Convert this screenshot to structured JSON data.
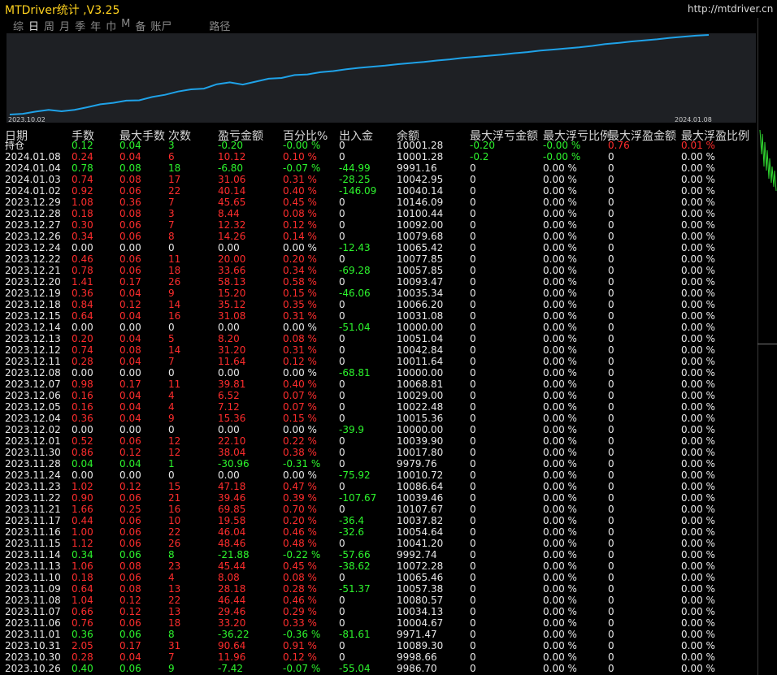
{
  "app_title": "MTDriver统计 ,V3.25",
  "url": "http://mtdriver.cn",
  "tabs": [
    {
      "label": "综",
      "active": false
    },
    {
      "label": "日",
      "active": true
    },
    {
      "label": "周",
      "active": false
    },
    {
      "label": "月",
      "active": false
    },
    {
      "label": "季",
      "active": false
    },
    {
      "label": "年",
      "active": false
    },
    {
      "label": "巾",
      "active": false
    },
    {
      "label": "M",
      "active": false
    },
    {
      "label": "备",
      "active": false
    },
    {
      "label": "账尸",
      "active": false
    },
    {
      "label": "路径",
      "active": false
    }
  ],
  "chart": {
    "start_date": "2023.10.02",
    "end_date": "2024.01.08",
    "line_color": "#1fa2e8",
    "equity": [
      10002,
      10004,
      10010,
      10015,
      10011,
      10015,
      10022,
      10030,
      10034,
      10040,
      10041,
      10050,
      10056,
      10065,
      10071,
      10073,
      10085,
      10090,
      10084,
      10092,
      10100,
      10102,
      10110,
      10112,
      10118,
      10121,
      10126,
      10130,
      10133,
      10136,
      10140,
      10143,
      10146,
      10150,
      10153,
      10157,
      10160,
      10163,
      10166,
      10170,
      10173,
      10177,
      10180,
      10183,
      10186,
      10190,
      10195,
      10198,
      10202,
      10205,
      10208,
      10212,
      10215,
      10218,
      10220
    ]
  },
  "columns": [
    "日期",
    "手数",
    "最大手数",
    "次数",
    "盈亏金额",
    "百分比%",
    "出入金",
    "余额",
    "最大浮亏金额",
    "最大浮亏比例",
    "最大浮盈金额",
    "最大浮盈比例"
  ],
  "rows": [
    {
      "c": [
        "持仓",
        "0.12",
        "0.04",
        "3",
        "-0.20",
        "-0.00 %",
        "0",
        "10001.28",
        "-0.20",
        "-0.00 %",
        "0.76",
        "0.01 %"
      ],
      "k": "g"
    },
    {
      "c": [
        "2024.01.08",
        "0.24",
        "0.04",
        "6",
        "10.12",
        "0.10 %",
        "0",
        "10001.28",
        "-0.2",
        "-0.00 %",
        "0",
        "0.00 %"
      ],
      "k": "r"
    },
    {
      "c": [
        "2024.01.04",
        "0.78",
        "0.08",
        "18",
        "-6.80",
        "-0.07 %",
        "-44.99",
        "9991.16",
        "0",
        "0.00 %",
        "0",
        "0.00 %"
      ],
      "k": "g"
    },
    {
      "c": [
        "2024.01.03",
        "0.74",
        "0.08",
        "17",
        "31.06",
        "0.31 %",
        "-28.25",
        "10042.95",
        "0",
        "0.00 %",
        "0",
        "0.00 %"
      ],
      "k": "r"
    },
    {
      "c": [
        "2024.01.02",
        "0.92",
        "0.06",
        "22",
        "40.14",
        "0.40 %",
        "-146.09",
        "10040.14",
        "0",
        "0.00 %",
        "0",
        "0.00 %"
      ],
      "k": "r"
    },
    {
      "c": [
        "2023.12.29",
        "1.08",
        "0.36",
        "7",
        "45.65",
        "0.45 %",
        "0",
        "10146.09",
        "0",
        "0.00 %",
        "0",
        "0.00 %"
      ],
      "k": "r"
    },
    {
      "c": [
        "2023.12.28",
        "0.18",
        "0.08",
        "3",
        "8.44",
        "0.08 %",
        "0",
        "10100.44",
        "0",
        "0.00 %",
        "0",
        "0.00 %"
      ],
      "k": "r"
    },
    {
      "c": [
        "2023.12.27",
        "0.30",
        "0.06",
        "7",
        "12.32",
        "0.12 %",
        "0",
        "10092.00",
        "0",
        "0.00 %",
        "0",
        "0.00 %"
      ],
      "k": "r"
    },
    {
      "c": [
        "2023.12.26",
        "0.34",
        "0.06",
        "8",
        "14.26",
        "0.14 %",
        "0",
        "10079.68",
        "0",
        "0.00 %",
        "0",
        "0.00 %"
      ],
      "k": "r"
    },
    {
      "c": [
        "2023.12.24",
        "0.00",
        "0.00",
        "0",
        "0.00",
        "0.00 %",
        "-12.43",
        "10065.42",
        "0",
        "0.00 %",
        "0",
        "0.00 %"
      ],
      "k": "w"
    },
    {
      "c": [
        "2023.12.22",
        "0.46",
        "0.06",
        "11",
        "20.00",
        "0.20 %",
        "0",
        "10077.85",
        "0",
        "0.00 %",
        "0",
        "0.00 %"
      ],
      "k": "r"
    },
    {
      "c": [
        "2023.12.21",
        "0.78",
        "0.06",
        "18",
        "33.66",
        "0.34 %",
        "-69.28",
        "10057.85",
        "0",
        "0.00 %",
        "0",
        "0.00 %"
      ],
      "k": "r"
    },
    {
      "c": [
        "2023.12.20",
        "1.41",
        "0.17",
        "26",
        "58.13",
        "0.58 %",
        "0",
        "10093.47",
        "0",
        "0.00 %",
        "0",
        "0.00 %"
      ],
      "k": "r"
    },
    {
      "c": [
        "2023.12.19",
        "0.36",
        "0.04",
        "9",
        "15.20",
        "0.15 %",
        "-46.06",
        "10035.34",
        "0",
        "0.00 %",
        "0",
        "0.00 %"
      ],
      "k": "r"
    },
    {
      "c": [
        "2023.12.18",
        "0.84",
        "0.12",
        "14",
        "35.12",
        "0.35 %",
        "0",
        "10066.20",
        "0",
        "0.00 %",
        "0",
        "0.00 %"
      ],
      "k": "r"
    },
    {
      "c": [
        "2023.12.15",
        "0.64",
        "0.04",
        "16",
        "31.08",
        "0.31 %",
        "0",
        "10031.08",
        "0",
        "0.00 %",
        "0",
        "0.00 %"
      ],
      "k": "r"
    },
    {
      "c": [
        "2023.12.14",
        "0.00",
        "0.00",
        "0",
        "0.00",
        "0.00 %",
        "-51.04",
        "10000.00",
        "0",
        "0.00 %",
        "0",
        "0.00 %"
      ],
      "k": "w"
    },
    {
      "c": [
        "2023.12.13",
        "0.20",
        "0.04",
        "5",
        "8.20",
        "0.08 %",
        "0",
        "10051.04",
        "0",
        "0.00 %",
        "0",
        "0.00 %"
      ],
      "k": "r"
    },
    {
      "c": [
        "2023.12.12",
        "0.74",
        "0.08",
        "14",
        "31.20",
        "0.31 %",
        "0",
        "10042.84",
        "0",
        "0.00 %",
        "0",
        "0.00 %"
      ],
      "k": "r"
    },
    {
      "c": [
        "2023.12.11",
        "0.28",
        "0.04",
        "7",
        "11.64",
        "0.12 %",
        "0",
        "10011.64",
        "0",
        "0.00 %",
        "0",
        "0.00 %"
      ],
      "k": "r"
    },
    {
      "c": [
        "2023.12.08",
        "0.00",
        "0.00",
        "0",
        "0.00",
        "0.00 %",
        "-68.81",
        "10000.00",
        "0",
        "0.00 %",
        "0",
        "0.00 %"
      ],
      "k": "w"
    },
    {
      "c": [
        "2023.12.07",
        "0.98",
        "0.17",
        "11",
        "39.81",
        "0.40 %",
        "0",
        "10068.81",
        "0",
        "0.00 %",
        "0",
        "0.00 %"
      ],
      "k": "r"
    },
    {
      "c": [
        "2023.12.06",
        "0.16",
        "0.04",
        "4",
        "6.52",
        "0.07 %",
        "0",
        "10029.00",
        "0",
        "0.00 %",
        "0",
        "0.00 %"
      ],
      "k": "r"
    },
    {
      "c": [
        "2023.12.05",
        "0.16",
        "0.04",
        "4",
        "7.12",
        "0.07 %",
        "0",
        "10022.48",
        "0",
        "0.00 %",
        "0",
        "0.00 %"
      ],
      "k": "r"
    },
    {
      "c": [
        "2023.12.04",
        "0.36",
        "0.04",
        "9",
        "15.36",
        "0.15 %",
        "0",
        "10015.36",
        "0",
        "0.00 %",
        "0",
        "0.00 %"
      ],
      "k": "r"
    },
    {
      "c": [
        "2023.12.02",
        "0.00",
        "0.00",
        "0",
        "0.00",
        "0.00 %",
        "-39.9",
        "10000.00",
        "0",
        "0.00 %",
        "0",
        "0.00 %"
      ],
      "k": "w"
    },
    {
      "c": [
        "2023.12.01",
        "0.52",
        "0.06",
        "12",
        "22.10",
        "0.22 %",
        "0",
        "10039.90",
        "0",
        "0.00 %",
        "0",
        "0.00 %"
      ],
      "k": "r"
    },
    {
      "c": [
        "2023.11.30",
        "0.86",
        "0.12",
        "12",
        "38.04",
        "0.38 %",
        "0",
        "10017.80",
        "0",
        "0.00 %",
        "0",
        "0.00 %"
      ],
      "k": "r"
    },
    {
      "c": [
        "2023.11.28",
        "0.04",
        "0.04",
        "1",
        "-30.96",
        "-0.31 %",
        "0",
        "9979.76",
        "0",
        "0.00 %",
        "0",
        "0.00 %"
      ],
      "k": "g"
    },
    {
      "c": [
        "2023.11.24",
        "0.00",
        "0.00",
        "0",
        "0.00",
        "0.00 %",
        "-75.92",
        "10010.72",
        "0",
        "0.00 %",
        "0",
        "0.00 %"
      ],
      "k": "w"
    },
    {
      "c": [
        "2023.11.23",
        "1.02",
        "0.12",
        "15",
        "47.18",
        "0.47 %",
        "0",
        "10086.64",
        "0",
        "0.00 %",
        "0",
        "0.00 %"
      ],
      "k": "r"
    },
    {
      "c": [
        "2023.11.22",
        "0.90",
        "0.06",
        "21",
        "39.46",
        "0.39 %",
        "-107.67",
        "10039.46",
        "0",
        "0.00 %",
        "0",
        "0.00 %"
      ],
      "k": "r"
    },
    {
      "c": [
        "2023.11.21",
        "1.66",
        "0.25",
        "16",
        "69.85",
        "0.70 %",
        "0",
        "10107.67",
        "0",
        "0.00 %",
        "0",
        "0.00 %"
      ],
      "k": "r"
    },
    {
      "c": [
        "2023.11.17",
        "0.44",
        "0.06",
        "10",
        "19.58",
        "0.20 %",
        "-36.4",
        "10037.82",
        "0",
        "0.00 %",
        "0",
        "0.00 %"
      ],
      "k": "r"
    },
    {
      "c": [
        "2023.11.16",
        "1.00",
        "0.06",
        "22",
        "46.04",
        "0.46 %",
        "-32.6",
        "10054.64",
        "0",
        "0.00 %",
        "0",
        "0.00 %"
      ],
      "k": "r"
    },
    {
      "c": [
        "2023.11.15",
        "1.12",
        "0.06",
        "26",
        "48.46",
        "0.48 %",
        "0",
        "10041.20",
        "0",
        "0.00 %",
        "0",
        "0.00 %"
      ],
      "k": "r"
    },
    {
      "c": [
        "2023.11.14",
        "0.34",
        "0.06",
        "8",
        "-21.88",
        "-0.22 %",
        "-57.66",
        "9992.74",
        "0",
        "0.00 %",
        "0",
        "0.00 %"
      ],
      "k": "g"
    },
    {
      "c": [
        "2023.11.13",
        "1.06",
        "0.08",
        "23",
        "45.44",
        "0.45 %",
        "-38.62",
        "10072.28",
        "0",
        "0.00 %",
        "0",
        "0.00 %"
      ],
      "k": "r"
    },
    {
      "c": [
        "2023.11.10",
        "0.18",
        "0.06",
        "4",
        "8.08",
        "0.08 %",
        "0",
        "10065.46",
        "0",
        "0.00 %",
        "0",
        "0.00 %"
      ],
      "k": "r"
    },
    {
      "c": [
        "2023.11.09",
        "0.64",
        "0.08",
        "13",
        "28.18",
        "0.28 %",
        "-51.37",
        "10057.38",
        "0",
        "0.00 %",
        "0",
        "0.00 %"
      ],
      "k": "r"
    },
    {
      "c": [
        "2023.11.08",
        "1.04",
        "0.12",
        "22",
        "46.44",
        "0.46 %",
        "0",
        "10080.57",
        "0",
        "0.00 %",
        "0",
        "0.00 %"
      ],
      "k": "r"
    },
    {
      "c": [
        "2023.11.07",
        "0.66",
        "0.12",
        "13",
        "29.46",
        "0.29 %",
        "0",
        "10034.13",
        "0",
        "0.00 %",
        "0",
        "0.00 %"
      ],
      "k": "r"
    },
    {
      "c": [
        "2023.11.06",
        "0.76",
        "0.06",
        "18",
        "33.20",
        "0.33 %",
        "0",
        "10004.67",
        "0",
        "0.00 %",
        "0",
        "0.00 %"
      ],
      "k": "r"
    },
    {
      "c": [
        "2023.11.01",
        "0.36",
        "0.06",
        "8",
        "-36.22",
        "-0.36 %",
        "-81.61",
        "9971.47",
        "0",
        "0.00 %",
        "0",
        "0.00 %"
      ],
      "k": "g"
    },
    {
      "c": [
        "2023.10.31",
        "2.05",
        "0.17",
        "31",
        "90.64",
        "0.91 %",
        "0",
        "10089.30",
        "0",
        "0.00 %",
        "0",
        "0.00 %"
      ],
      "k": "r"
    },
    {
      "c": [
        "2023.10.30",
        "0.28",
        "0.04",
        "7",
        "11.96",
        "0.12 %",
        "0",
        "9998.66",
        "0",
        "0.00 %",
        "0",
        "0.00 %"
      ],
      "k": "r"
    },
    {
      "c": [
        "2023.10.26",
        "0.40",
        "0.06",
        "9",
        "-7.42",
        "-0.07 %",
        "-55.04",
        "9986.70",
        "0",
        "0.00 %",
        "0",
        "0.00 %"
      ],
      "k": "g"
    }
  ]
}
